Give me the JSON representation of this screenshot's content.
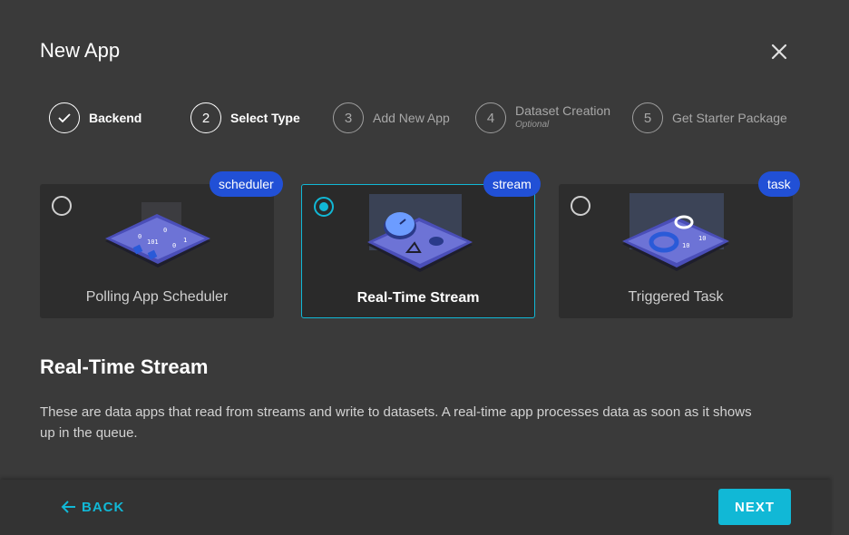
{
  "dialog": {
    "title": "New App"
  },
  "steps": [
    {
      "number": "",
      "label": "Backend",
      "state": "done"
    },
    {
      "number": "2",
      "label": "Select Type",
      "state": "active"
    },
    {
      "number": "3",
      "label": "Add New App",
      "state": "pending"
    },
    {
      "number": "4",
      "label": "Dataset Creation",
      "sublabel": "Optional",
      "state": "pending"
    },
    {
      "number": "5",
      "label": "Get Starter Package",
      "state": "pending"
    }
  ],
  "cards": [
    {
      "label": "Polling App Scheduler",
      "badge": "scheduler",
      "selected": false
    },
    {
      "label": "Real-Time Stream",
      "badge": "stream",
      "selected": true
    },
    {
      "label": "Triggered Task",
      "badge": "task",
      "selected": false
    }
  ],
  "illustration_text": {
    "scheduler": [
      "0",
      "101",
      "0",
      "0",
      "1"
    ],
    "task": [
      "10",
      "10"
    ]
  },
  "selected_type": {
    "title": "Real-Time Stream",
    "description": "These are data apps that read from streams and write to datasets. A real-time app processes data as soon as it shows up in the queue."
  },
  "footer": {
    "back_label": "BACK",
    "next_label": "NEXT"
  },
  "colors": {
    "accent": "#11b8d6",
    "badge": "#2150d6",
    "background": "#3a3a3a",
    "card": "#2d2d2d"
  }
}
